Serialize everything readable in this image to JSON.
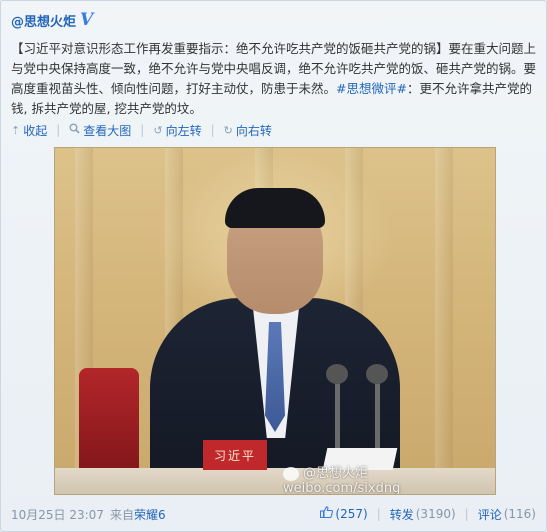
{
  "post": {
    "author": "@思想火炬",
    "verified_mark": "V",
    "text_main": "【习近平对意识形态工作再发重要指示：绝不允许吃共产党的饭砸共产党的锅】要在重大问题上与党中央保持高度一致，绝不允许与党中央唱反调，绝不允许吃共产党的饭、砸共产党的锅。要高度重视苗头性、倾向性问题，打好主动仗，防患于未然。",
    "hashtag": "#思想微评#",
    "text_tail": "：更不允许拿共产党的钱, 拆共产党的屋, 挖共产党的坟。"
  },
  "actions": {
    "collapse": "收起",
    "view_large": "查看大图",
    "rotate_left": "向左转",
    "rotate_right": "向右转"
  },
  "photo": {
    "nameplate_text": "习近平",
    "watermark_brand": "@思想火炬",
    "watermark_url": "weibo.com/sixdng"
  },
  "footer": {
    "time": "10月25日 23:07",
    "source_prefix": "来自",
    "source": "荣耀6",
    "likes": "(257)",
    "repost_label": "转发",
    "repost_count": "(3190)",
    "comment_label": "评论",
    "comment_count": "(116)"
  },
  "icons": {
    "collapse": "arrow-up-icon",
    "view_large": "magnifier-icon",
    "rotate_left": "rotate-left-icon",
    "rotate_right": "rotate-right-icon",
    "like": "thumb-up-icon"
  },
  "colors": {
    "link": "#2266bb",
    "muted": "#8896a5",
    "background": "#eef3f7"
  }
}
